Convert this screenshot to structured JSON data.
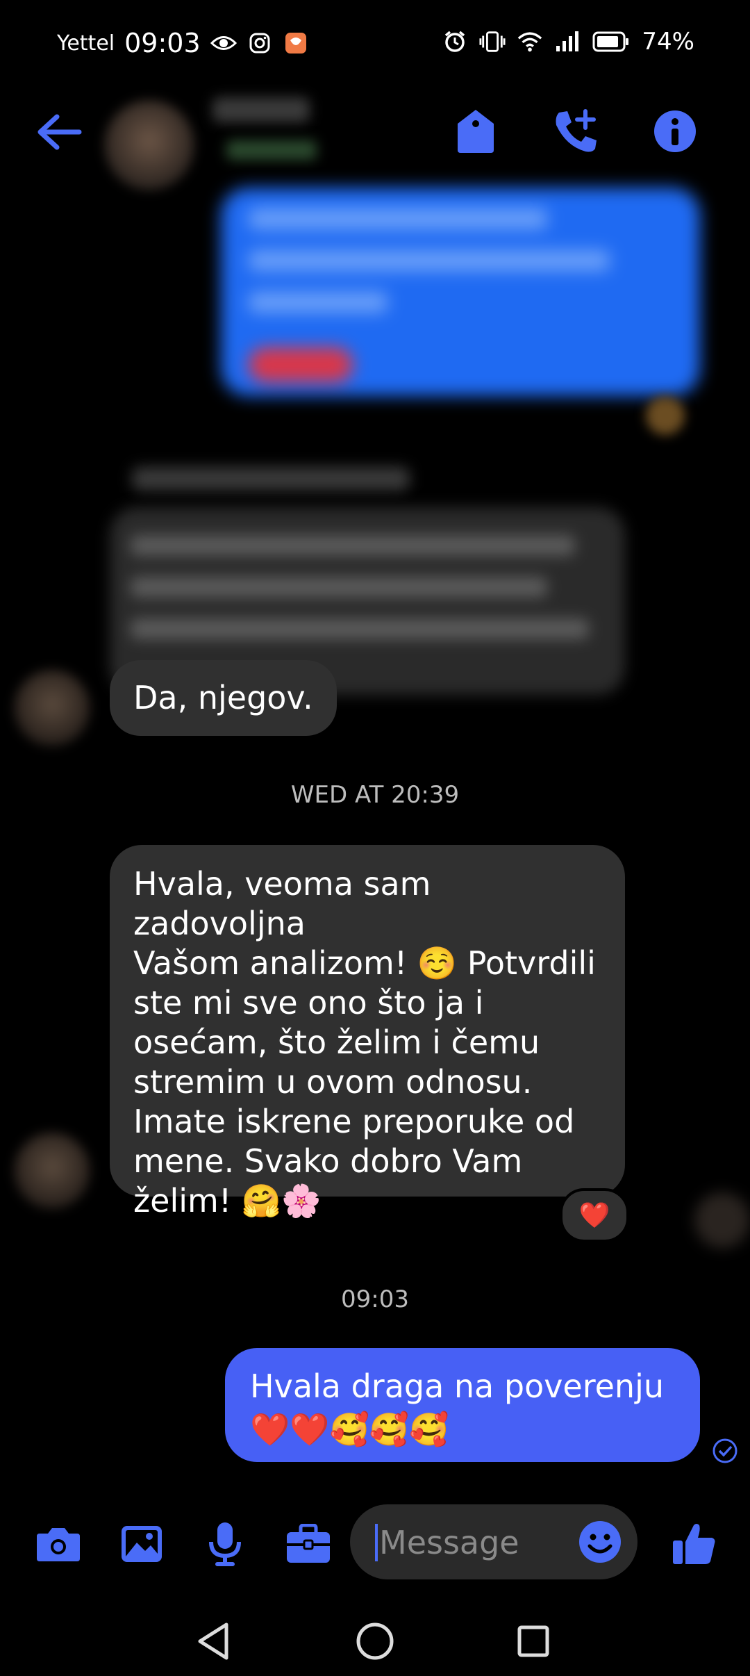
{
  "status_bar": {
    "carrier": "Yettel",
    "time": "09:03",
    "battery_percent": "74%"
  },
  "conversation": {
    "last_incoming_short": "Da, njegov.",
    "timestamp_1": "WED AT 20:39",
    "incoming_long_lines": [
      "Hvala, veoma sam zadovoljna",
      "Vašom analizom! ☺️ Potvrdili",
      "ste mi sve ono što ja i",
      "osećam, što želim i čemu",
      "stremim u ovom odnosu.",
      "Imate iskrene preporuke od",
      "mene. Svako dobro Vam",
      "želim! 🤗🌸"
    ],
    "reaction": "❤️",
    "timestamp_2": "09:03",
    "outgoing_text": "Hvala draga na poverenju",
    "outgoing_emojis": "❤️❤️🥰🥰🥰"
  },
  "composer": {
    "placeholder": "Message"
  },
  "colors": {
    "accent": "#4a6cf7",
    "outgoing_bubble": "#4760f5",
    "incoming_bubble": "#303030"
  }
}
